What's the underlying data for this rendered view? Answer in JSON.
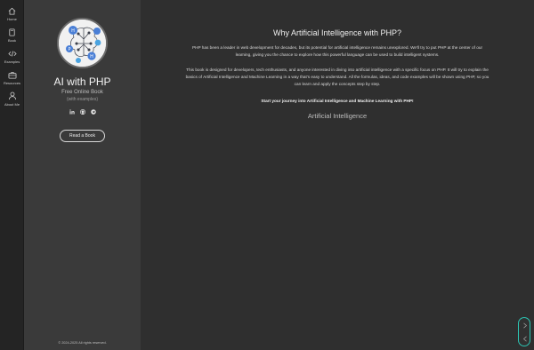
{
  "nav": {
    "items": [
      {
        "label": "Home",
        "icon": "home-icon"
      },
      {
        "label": "Book",
        "icon": "book-icon"
      },
      {
        "label": "Examples",
        "icon": "code-icon"
      },
      {
        "label": "Resources",
        "icon": "resources-icon"
      },
      {
        "label": "About Me",
        "icon": "user-icon"
      }
    ]
  },
  "profile": {
    "title": "AI with PHP",
    "subtitle": "Free Online Book",
    "note": "(with examples)",
    "socials": [
      "linkedin-icon",
      "github-icon",
      "telegram-icon"
    ],
    "button_label": "Read a Book",
    "copyright": "© 2024-2025 All rights reserved."
  },
  "content": {
    "heading": "Why Artificial Intelligence with PHP?",
    "paragraph_1": "PHP has been a leader in web development for decades, but its potential for artificial intelligence remains unexplored. We'll try to put PHP at the center of our learning, giving you the chance to explore how this powerful language can be used to build intelligent systems.",
    "paragraph_2": "This book is designed for developers, tech enthusiasts, and anyone interested in diving into artificial intelligence with a specific focus on PHP. It will try to explain the basics of Artificial Intelligence and Machine Learning in a way that's easy to understand. All the formulas, ideas, and code examples will be shown using PHP, so you can learn and apply the concepts step by step.",
    "cta": "Start your journey into Artificial Intelligence and Machine Learning with PHP!",
    "topic": "Artificial Intelligence"
  },
  "colors": {
    "accent": "#2cc4b3",
    "panel": "#3a3a3a",
    "rail": "#242424",
    "background": "#2f2f2f"
  }
}
